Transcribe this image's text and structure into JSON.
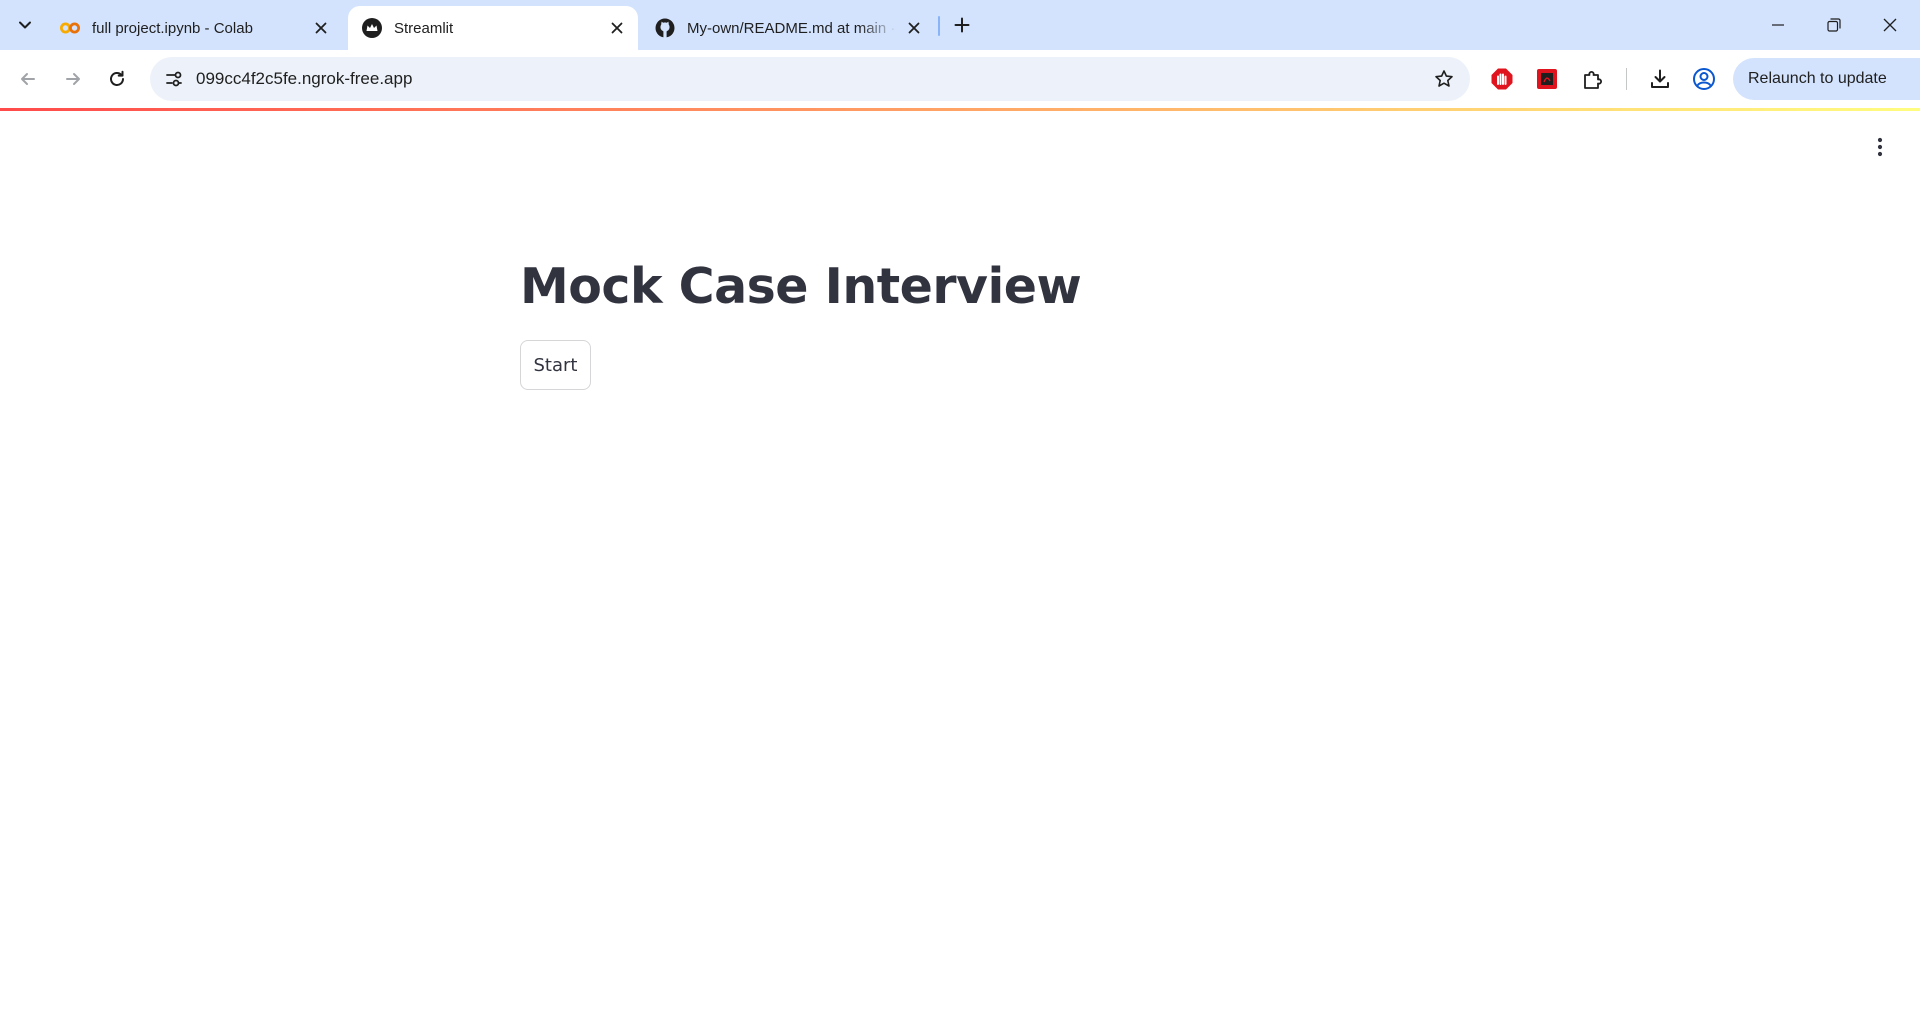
{
  "browser": {
    "tabs": [
      {
        "title": "full project.ipynb - Colab",
        "icon": "colab-icon",
        "active": false
      },
      {
        "title": "Streamlit",
        "icon": "streamlit-icon",
        "active": true
      },
      {
        "title": "My-own/README.md at main · ",
        "icon": "github-icon",
        "active": false
      }
    ],
    "url": "099cc4f2c5fe.ngrok-free.app",
    "relaunch_label": "Relaunch to update",
    "colors": {
      "tabstrip": "#d3e3fd",
      "omnibox": "#edf2fa",
      "accent_tab_separator": "#8ab4f8"
    }
  },
  "app": {
    "title": "Mock Case Interview",
    "start_label": "Start",
    "colors": {
      "text": "#31333f",
      "decoration_start": "#ff4b4b",
      "decoration_end": "#fffd80"
    }
  }
}
